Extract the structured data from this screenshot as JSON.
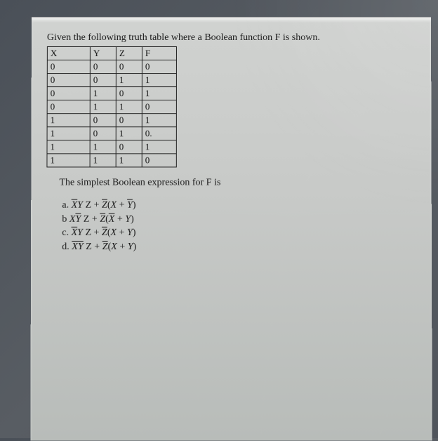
{
  "prompt": "Given the following truth table where a Boolean function F is shown.",
  "table": {
    "headers": [
      "X",
      "Y",
      "Z",
      "F"
    ],
    "rows": [
      [
        "0",
        "0",
        "0",
        "0"
      ],
      [
        "0",
        "0",
        "1",
        "1"
      ],
      [
        "0",
        "1",
        "0",
        "1"
      ],
      [
        "0",
        "1",
        "1",
        "0"
      ],
      [
        "1",
        "0",
        "0",
        "1"
      ],
      [
        "1",
        "0",
        "1",
        "0."
      ],
      [
        "1",
        "1",
        "0",
        "1"
      ],
      [
        "1",
        "1",
        "1",
        "0"
      ]
    ]
  },
  "question": "The simplest Boolean expression for F is",
  "options": {
    "a": {
      "label": "a.",
      "parts": [
        "Xbar",
        "Y",
        " Z + ",
        "Zbar",
        "(X + ",
        "Ybar",
        ")"
      ]
    },
    "b": {
      "label": "b",
      "parts": [
        "X",
        "Ybar",
        " Z + ",
        "Zbar",
        "(",
        "Xbar",
        " + Y)"
      ]
    },
    "c": {
      "label": "c.",
      "parts": [
        "Xbar",
        "Y Z + ",
        "Zbar",
        "(X + Y)"
      ]
    },
    "d": {
      "label": "d.",
      "parts": [
        "Xbar",
        "Ybar",
        " Z + ",
        "Zbar",
        "(X + Y)"
      ]
    }
  }
}
